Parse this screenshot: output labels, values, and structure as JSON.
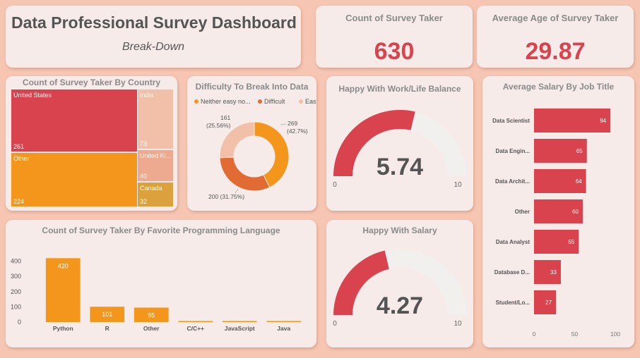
{
  "header": {
    "title": "Data Professional Survey Dashboard",
    "subtitle": "Break-Down"
  },
  "kpi_count": {
    "label": "Count of Survey Taker",
    "value": "630"
  },
  "kpi_age": {
    "label": "Average Age of Survey Taker",
    "value": "29.87"
  },
  "colors": {
    "red": "#d9434e",
    "orange": "#f5961c",
    "dark_orange": "#e26b34",
    "peach": "#f2c0a8",
    "salmon": "#eeaa90",
    "mustard": "#dca03c",
    "track": "#f2f0ef",
    "title_gray": "#8a8a8a"
  },
  "chart_data": [
    {
      "type": "treemap",
      "title": "Count of Survey Taker By Country",
      "items": [
        {
          "name": "United States",
          "value": 261
        },
        {
          "name": "Other",
          "value": 224
        },
        {
          "name": "India",
          "value": 73
        },
        {
          "name": "United Ki...",
          "value": 40
        },
        {
          "name": "Canada",
          "value": 32
        }
      ]
    },
    {
      "type": "pie",
      "title": "Difficulty To Break Into Data",
      "legend": [
        "Neither easy no...",
        "Difficult",
        "Easy"
      ],
      "slices": [
        {
          "name": "Neither easy no...",
          "value": 269,
          "label": "269",
          "pct": "(42.7%)"
        },
        {
          "name": "Difficult",
          "value": 200,
          "label": "200 (31.75%)"
        },
        {
          "name": "Easy",
          "value": 161,
          "label": "161",
          "pct": "(25.56%)"
        }
      ]
    },
    {
      "type": "gauge",
      "title": "Happy With Work/Life Balance",
      "value": 5.74,
      "value_label": "5.74",
      "min": 0,
      "max": 10,
      "min_label": "0",
      "max_label": "10"
    },
    {
      "type": "gauge",
      "title": "Happy With Salary",
      "value": 4.27,
      "value_label": "4.27",
      "min": 0,
      "max": 10,
      "min_label": "0",
      "max_label": "10"
    },
    {
      "type": "bar",
      "title": "Count of Survey Taker By Favorite Programming Language",
      "categories": [
        "Python",
        "R",
        "Other",
        "C/C++",
        "JavaScript",
        "Java"
      ],
      "values": [
        420,
        101,
        95,
        0,
        0,
        0
      ],
      "data_labels": [
        "420",
        "101",
        "95",
        "",
        "",
        ""
      ],
      "yticks": [
        "0",
        "100",
        "200",
        "300",
        "400"
      ],
      "ylim": [
        0,
        440
      ]
    },
    {
      "type": "bar",
      "orientation": "horizontal",
      "title": "Average Salary By Job Title",
      "categories": [
        "Data Scientist",
        "Data Engin...",
        "Data Archit...",
        "Other",
        "Data Analyst",
        "Database D...",
        "Student/Lo..."
      ],
      "values": [
        94,
        65,
        64,
        60,
        55,
        33,
        27
      ],
      "data_labels": [
        "94",
        "65",
        "64",
        "60",
        "55",
        "33",
        "27"
      ],
      "xticks": [
        "0",
        "50",
        "100"
      ],
      "xlim": [
        0,
        100
      ]
    }
  ]
}
